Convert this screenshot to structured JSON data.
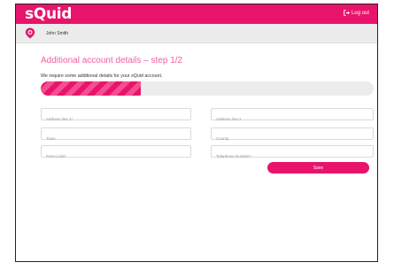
{
  "app": {
    "logo": "sQuid",
    "logout_label": "Log out"
  },
  "user": {
    "name": "John Smith"
  },
  "page": {
    "title": "Additional account details – step 1/2",
    "subtitle": "We require some additional details for your sQuid account."
  },
  "progress": {
    "fraction": 0.3
  },
  "form": {
    "address_line1_placeholder": "Address line 1*",
    "address_line2_placeholder": "Address line 2",
    "town_placeholder": "Town",
    "county_placeholder": "County",
    "post_code_placeholder": "Post Code*",
    "telephone_placeholder": "Telephone Number*",
    "save_label": "Save"
  },
  "colors": {
    "brand": "#e8146b",
    "title": "#ef5fa0",
    "userbar": "#ececec"
  },
  "icons": {
    "logout": "logout-arrow-icon",
    "avatar": "location-pin-avatar-icon"
  }
}
